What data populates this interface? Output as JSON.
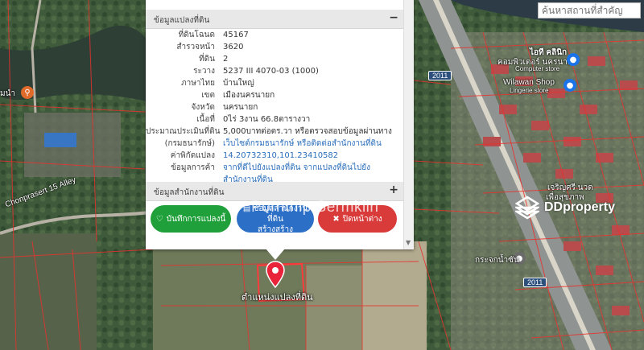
{
  "search": {
    "placeholder": "ค้นหาสถานที่สำคัญ"
  },
  "map_labels": {
    "it_clinic_1": "ไอที คลินิก",
    "it_clinic_2": "คอมพิวเตอร์ นครนาย",
    "computer_store": "Computer store",
    "wilawan_shop": "Wilawan Shop",
    "lingerie_store": "Lingerie store",
    "road_2011_a": "2011",
    "road_2011_b": "2011",
    "chonprasert_alley": "Chonprasert 15 Alley",
    "left_poi": "มนำ",
    "right_poi_1": "เจริญศรี นวด",
    "right_poi_2": "เพื่อสุขภาพ",
    "right_poi_3": "กระจกน้ำซัน",
    "marker_caption": "ตำแหน่งแปลงที่ดิน"
  },
  "popup": {
    "section1_title": "ข้อมูลแปลงที่ดิน",
    "section1_toggle": "−",
    "rows": [
      {
        "k": "ที่ดินโฉนด",
        "v": "45167"
      },
      {
        "k": "สำรวจหน้า",
        "v": "3620"
      },
      {
        "k": "ที่ดิน",
        "v": "2"
      },
      {
        "k": "ระวาง",
        "v": "5237 III 4070-03 (1000)"
      },
      {
        "k": "ภาษาไทย",
        "v": "บ้านใหญ่"
      },
      {
        "k": "เขต",
        "v": "เมืองนครนายก"
      },
      {
        "k": "จังหวัด",
        "v": "นครนายก"
      },
      {
        "k": "เนื้อที่",
        "v": "0ไร่ 3งาน 66.8ตารางวา"
      },
      {
        "k": "ประมาณประเมินที่ดิน",
        "v": "5,000บาทต่อตร.วา หรือตรวจสอบข้อมูลผ่านทาง"
      },
      {
        "k": "(กรมธนารักษ์)",
        "v": "เว็บไซต์กรมธนารักษ์ หรือติดต่อสำนักงานที่ดิน"
      },
      {
        "k": "ค่าพิกัดแปลง",
        "v": "14.20732310,101.23410582"
      },
      {
        "k": "ข้อมูลการค้า",
        "v": "จากที่ดีไปยังแปลงที่ดิน จากแปลงที่ดินไปยัง"
      },
      {
        "k": "",
        "v": "สำนักงานที่ดิน"
      }
    ],
    "section2_title": "ข้อมูลสำนักงานที่ดิน",
    "section2_toggle": "+",
    "btn_save": "บันทึกการแปลงนี้",
    "btn_create_1": "ข้อมูลสำนักงานที่ดิน",
    "btn_create_2": "สร้างสร้าง",
    "btn_close": "ปิดหน้าต่าง"
  },
  "watermark": {
    "agent_name": "Pornthip Sermklin",
    "brand": "DDproperty"
  },
  "colors": {
    "save": "#1fa03a",
    "create": "#2c6fc6",
    "close": "#d93b3b",
    "marker": "#e8233a",
    "parcel_lines": "#e8322f"
  }
}
